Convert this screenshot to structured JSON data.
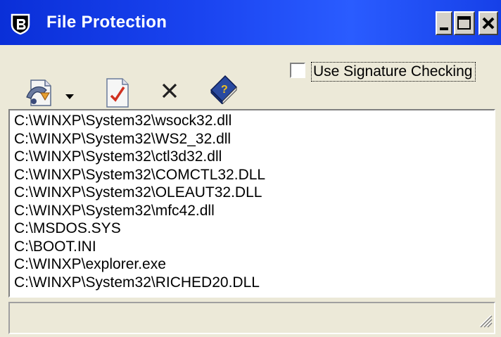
{
  "window": {
    "title": "File Protection",
    "app_icon": "shield-icon"
  },
  "controls": {
    "minimize_icon": "minimize-icon",
    "maximize_icon": "maximize-icon",
    "close_icon": "close-icon"
  },
  "toolbar": {
    "buttons": [
      {
        "icon": "add-file-icon"
      },
      {
        "icon": "dropdown-arrow-icon"
      },
      {
        "icon": "checked-document-icon"
      },
      {
        "icon": "delete-x-icon"
      },
      {
        "icon": "help-book-icon"
      }
    ],
    "signature_checkbox": {
      "label": "Use Signature Checking",
      "checked": false
    }
  },
  "file_list": {
    "items": [
      "C:\\WINXP\\System32\\wsock32.dll",
      "C:\\WINXP\\System32\\WS2_32.dll",
      "C:\\WINXP\\System32\\ctl3d32.dll",
      "C:\\WINXP\\System32\\COMCTL32.DLL",
      "C:\\WINXP\\System32\\OLEAUT32.DLL",
      "C:\\WINXP\\System32\\mfc42.dll",
      "C:\\MSDOS.SYS",
      "C:\\BOOT.INI",
      "C:\\WINXP\\explorer.exe",
      "C:\\WINXP\\System32\\RICHED20.DLL"
    ]
  },
  "statusbar": {
    "text": "",
    "grip_icon": "resize-grip-icon"
  },
  "colors": {
    "titlebar": "#1a44f0",
    "face": "#ece9d8",
    "list_background": "#ffffff"
  }
}
